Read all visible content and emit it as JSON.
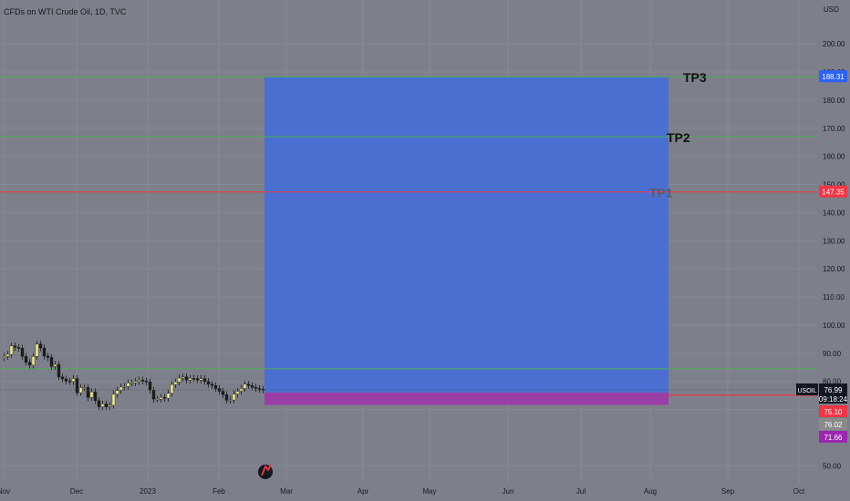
{
  "header": {
    "title": "CFDs on WTI Crude Oil, 1D, TVC"
  },
  "chart_data": {
    "type": "candlestick",
    "symbol": "USOIL",
    "currency_label": "USD",
    "ylim": [
      45,
      210
    ],
    "y_ticks": [
      "50.00",
      "70.00",
      "80.00",
      "90.00",
      "100.00",
      "110.00",
      "120.00",
      "130.00",
      "140.00",
      "150.00",
      "160.00",
      "170.00",
      "180.00",
      "190.00",
      "200.00"
    ],
    "x_ticks": [
      "Nov",
      "Dec",
      "2023",
      "Feb",
      "Mar",
      "Apr",
      "May",
      "Jun",
      "Jul",
      "Aug",
      "Sep",
      "Oct"
    ],
    "candles_close": [
      88.9,
      89.6,
      92.6,
      92.1,
      91.8,
      88.9,
      86.8,
      85.8,
      88.9,
      93.3,
      91.9,
      89.0,
      88.5,
      85.3,
      86.0,
      81.6,
      80.9,
      80.1,
      80.0,
      81.0,
      76.0,
      77.8,
      77.8,
      74.3,
      76.3,
      73.2,
      71.0,
      72.0,
      71.0,
      71.5,
      75.5,
      76.8,
      78.0,
      78.2,
      79.5,
      79.5,
      80.0,
      80.5,
      80.1,
      79.8,
      76.9,
      73.7,
      73.7,
      74.3,
      74.0,
      75.8,
      78.9,
      79.8,
      81.2,
      81.6,
      80.5,
      81.1,
      81.0,
      80.5,
      81.0,
      80.0,
      79.0,
      78.5,
      77.5,
      76.5,
      75.3,
      73.3,
      73.4,
      75.5,
      76.5,
      77.5,
      79.0,
      78.5,
      77.9,
      77.5,
      77.2,
      76.99
    ],
    "bull_candle_color": "#f2f28c",
    "bear_candle_color": "#1c1c1c",
    "levels": [
      {
        "label": "TP3",
        "value": 188.31,
        "badge": "188.31",
        "color": "#4caf50",
        "badge_color": "#2962ff"
      },
      {
        "label": "TP2",
        "value": 167.0,
        "badge": "",
        "color": "#4caf50",
        "badge_color": ""
      },
      {
        "label": "TP1",
        "value": 147.35,
        "badge": "147.35",
        "color": "#f23645",
        "badge_color": "#f23645"
      },
      {
        "label": "",
        "value": 84.5,
        "badge": "",
        "color": "#4caf50",
        "badge_color": ""
      }
    ],
    "position": {
      "target": 188.31,
      "entry": 76.02,
      "stop": 71.66,
      "profit_color": "#4a6fd1",
      "loss_color": "#9c3ea8"
    },
    "last_price": "76.99",
    "countdown": "09:18:24",
    "price_badges": [
      {
        "text": "75.10",
        "value": 75.1,
        "color": "#f23645"
      },
      {
        "text": "76.02",
        "value": 73.1,
        "color": "#8a8a8a"
      },
      {
        "text": "71.66",
        "value": 71.0,
        "color": "#9c27b0"
      }
    ]
  }
}
